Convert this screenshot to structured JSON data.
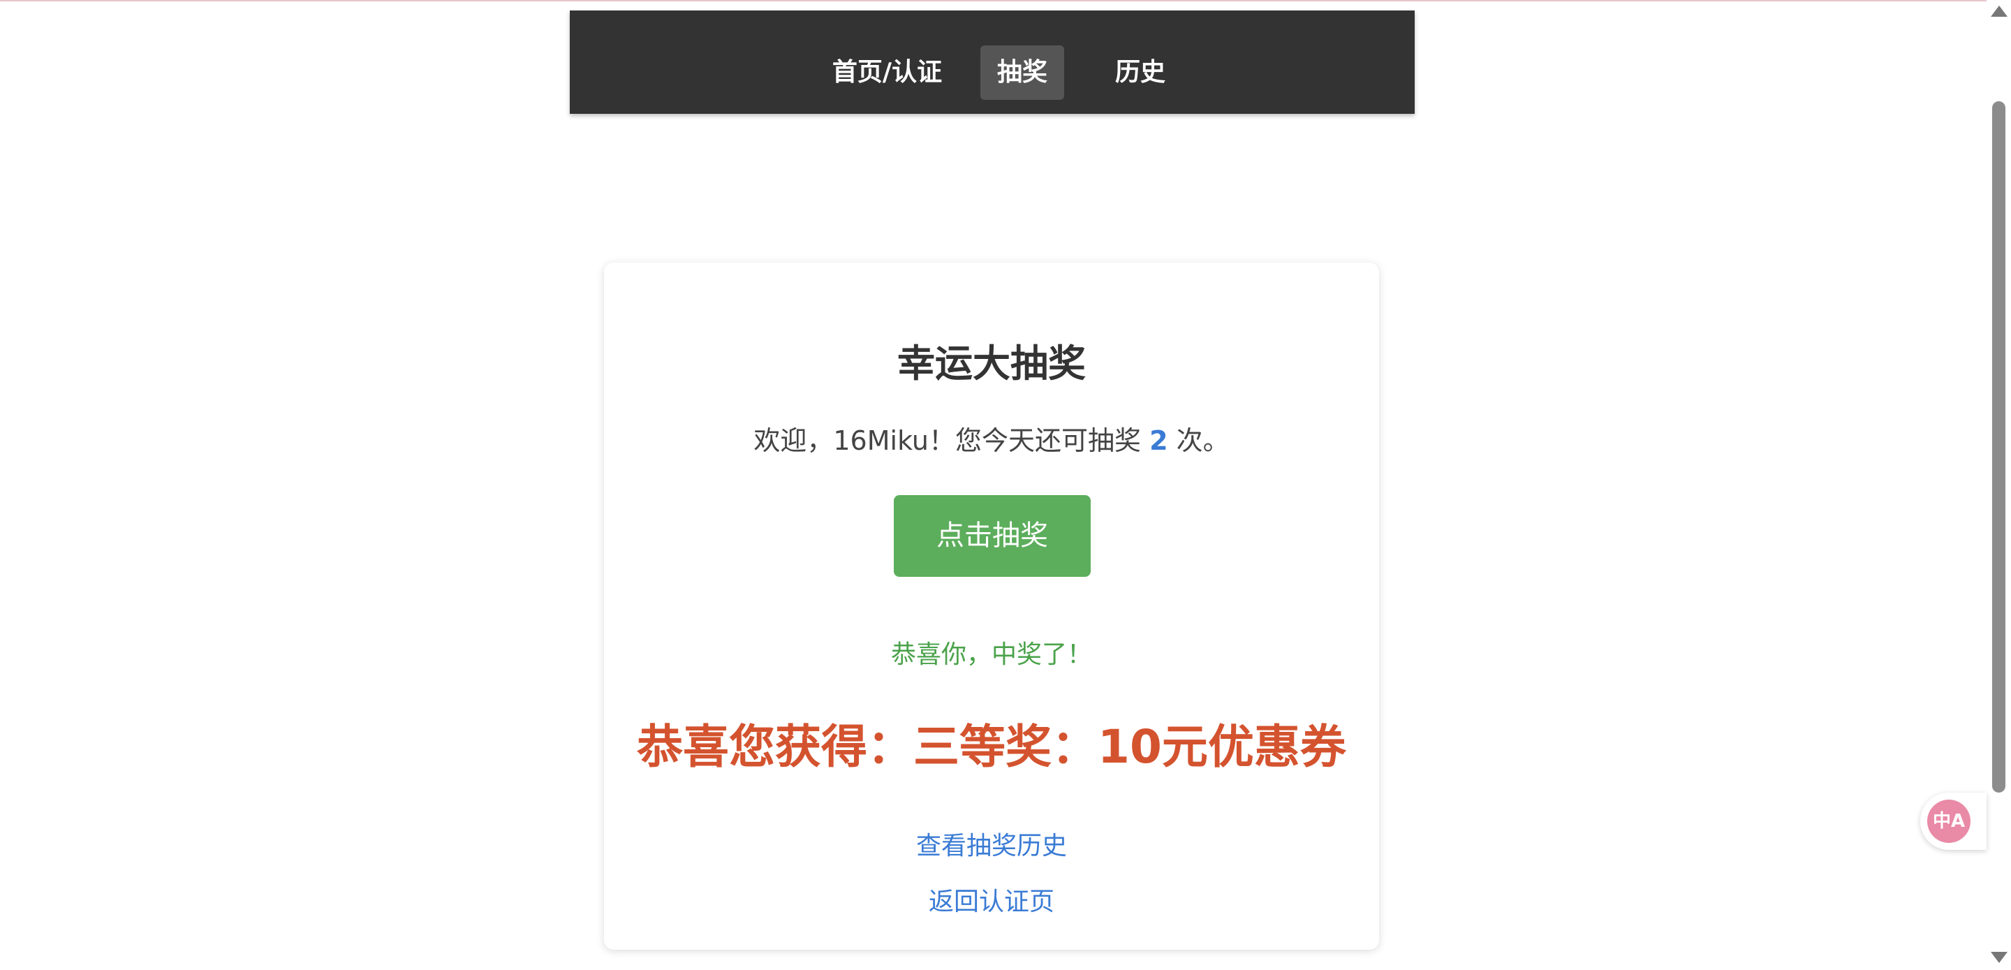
{
  "nav": {
    "items": [
      {
        "label": "首页/认证"
      },
      {
        "label": "抽奖"
      },
      {
        "label": "历史"
      }
    ]
  },
  "card": {
    "title": "幸运大抽奖",
    "welcome_prefix": "欢迎，16Miku！您今天还可抽奖 ",
    "remaining_count": "2",
    "welcome_suffix": " 次。",
    "draw_button": "点击抽奖",
    "congrats": "恭喜你，中奖了！",
    "prize": "恭喜您获得：三等奖：10元优惠券",
    "history_link": "查看抽奖历史",
    "back_link": "返回认证页"
  },
  "floating": {
    "translate_icon": "translate-icon",
    "translate_glyph": "中A"
  },
  "colors": {
    "nav_bg": "#333333",
    "nav_active_bg": "#555555",
    "button_green": "#5cad5c",
    "success_green": "#4aa24a",
    "prize_red": "#d4532f",
    "link_blue": "#3a7bd5"
  }
}
